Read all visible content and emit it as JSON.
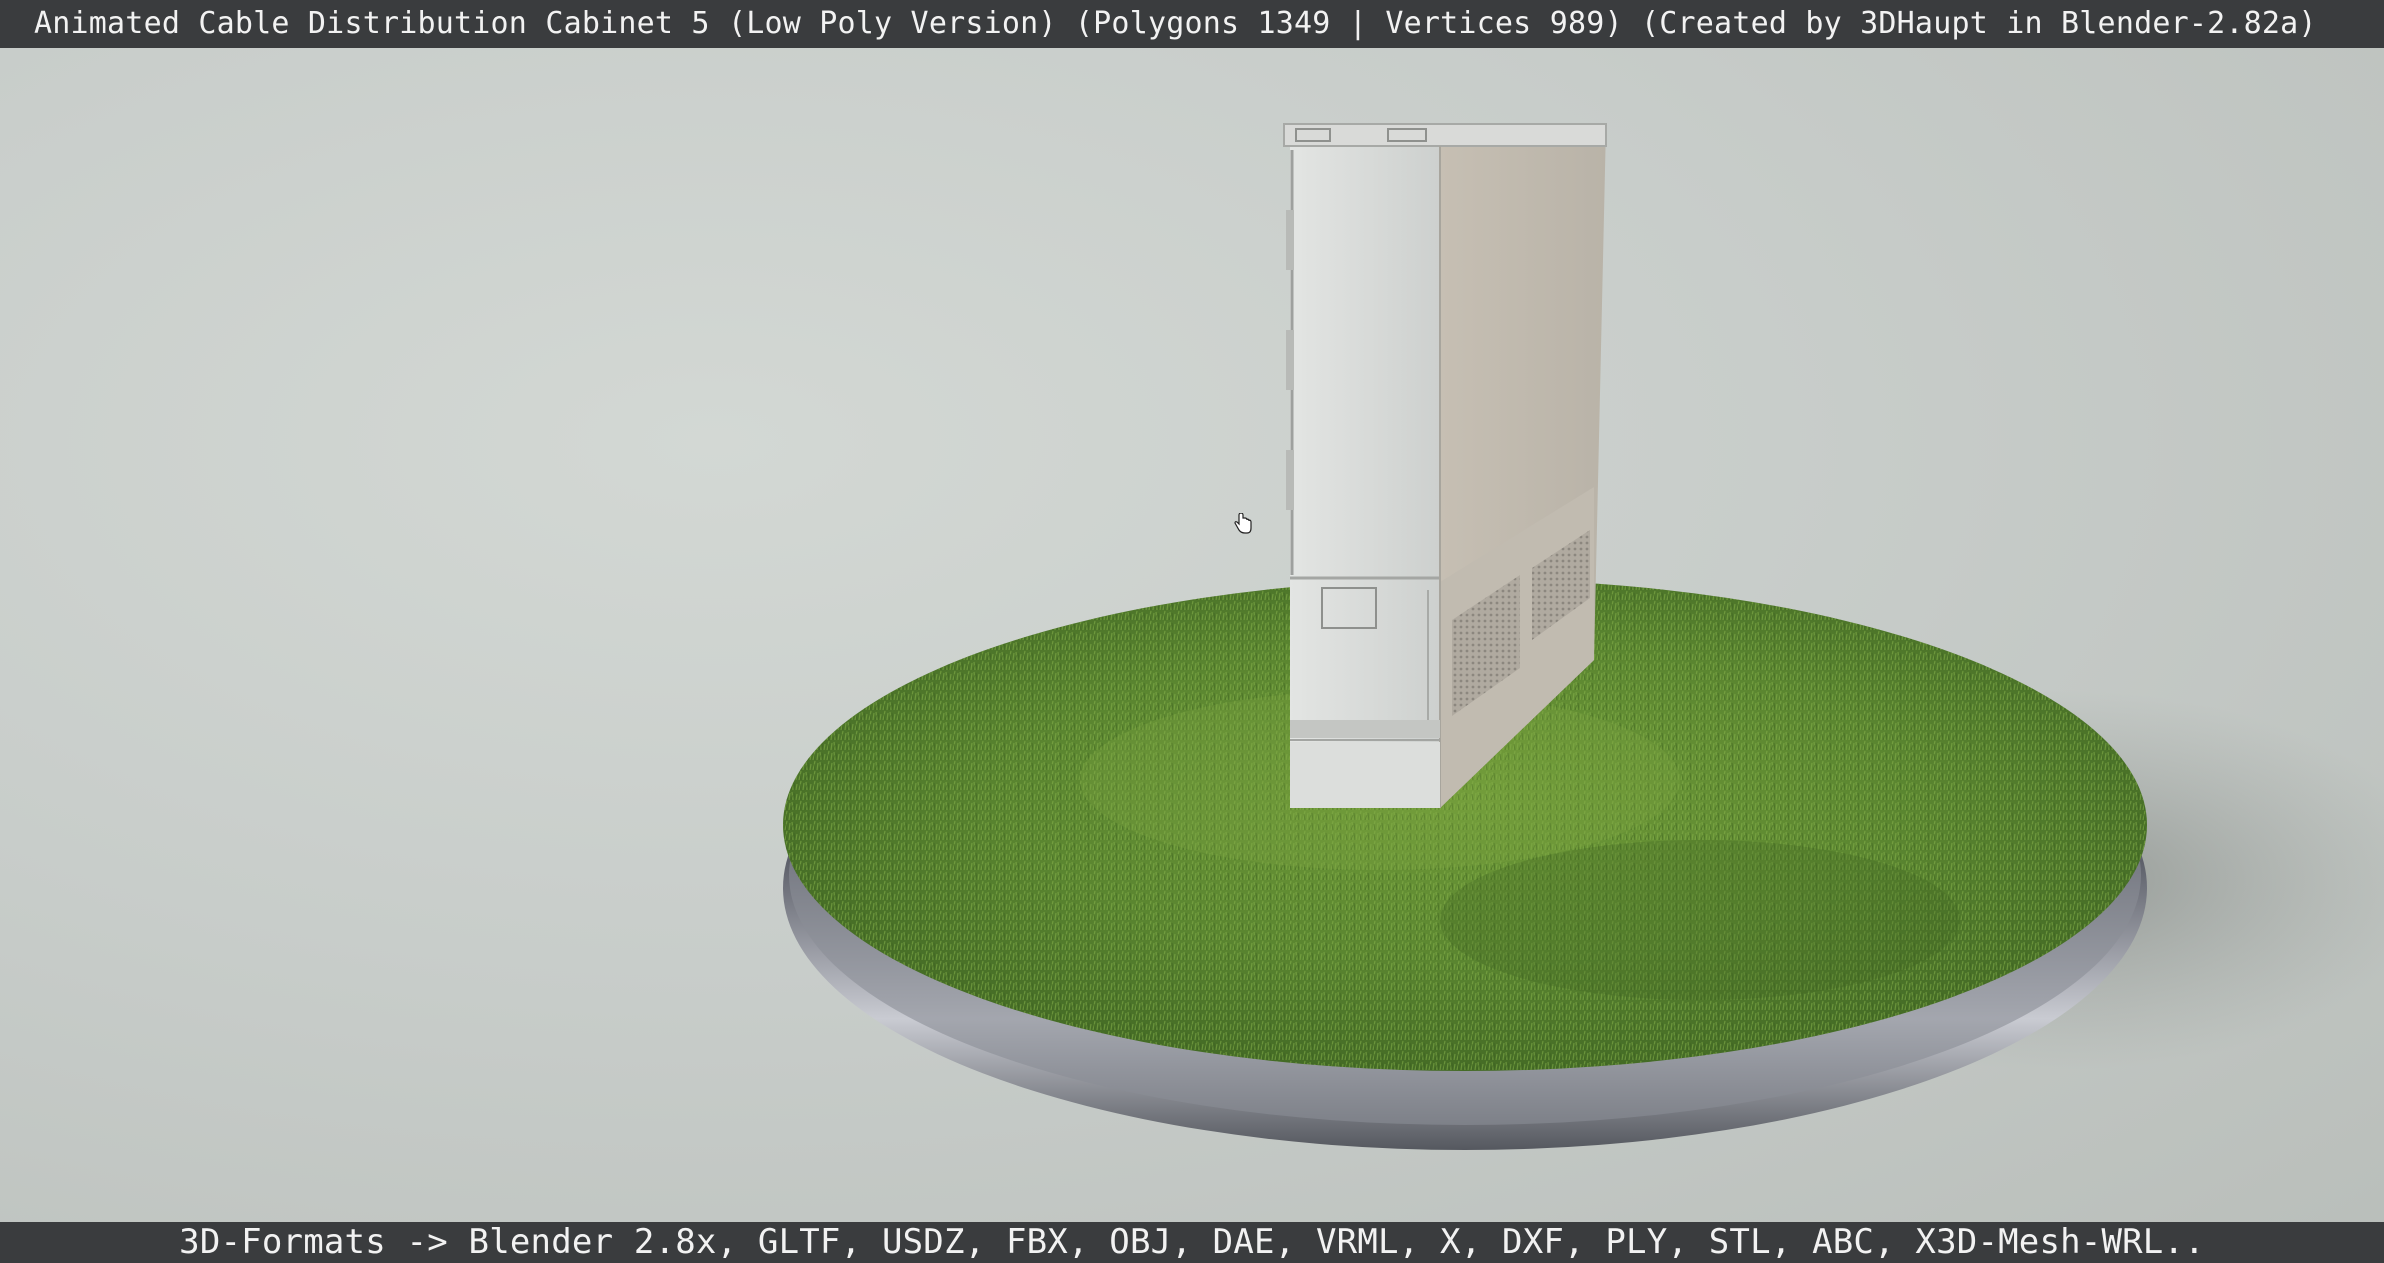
{
  "title_bar": {
    "text": "Animated Cable Distribution Cabinet 5 (Low Poly Version) (Polygons 1349 | Vertices 989) (Created by 3DHaupt in Blender-2.82a)"
  },
  "formats_bar": {
    "text": "3D-Formats -> Blender 2.8x, GLTF, USDZ, FBX, OBJ, DAE, VRML, X, DXF, PLY, STL, ABC, X3D-Mesh-WRL.."
  },
  "viewport": {
    "cursor_icon": "hand-cursor-icon",
    "colors": {
      "bar_background": "#3a3c3e",
      "bar_text": "#f2f2f2",
      "backdrop": "#c9ceca",
      "grass": "#5e8a2c",
      "base_rim": "#6e717a",
      "cabinet": "#d6d8d6"
    }
  }
}
